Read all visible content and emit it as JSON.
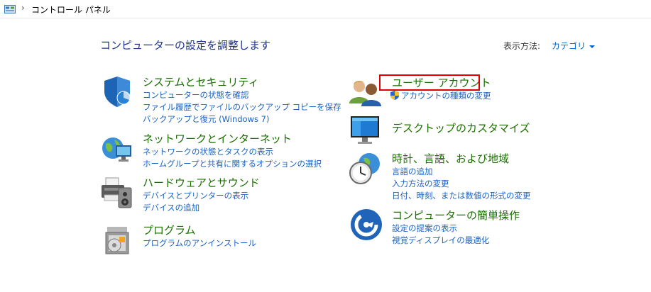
{
  "address_bar": {
    "separator": "›",
    "breadcrumb": "コントロール パネル",
    "icon": "control-panel-icon"
  },
  "heading": "コンピューターの設定を調整します",
  "view_by": {
    "label": "表示方法:",
    "value": "カテゴリ"
  },
  "highlight_color": "#e00000",
  "categories_left": [
    {
      "title": "システムとセキュリティ",
      "icon": "shield-icon",
      "links": [
        "コンピューターの状態を確認",
        "ファイル履歴でファイルのバックアップ コピーを保存",
        "バックアップと復元 (Windows 7)"
      ]
    },
    {
      "title": "ネットワークとインターネット",
      "icon": "network-globe-icon",
      "links": [
        "ネットワークの状態とタスクの表示",
        "ホームグループと共有に関するオプションの選択"
      ]
    },
    {
      "title": "ハードウェアとサウンド",
      "icon": "printer-speaker-icon",
      "links": [
        "デバイスとプリンターの表示",
        "デバイスの追加"
      ]
    },
    {
      "title": "プログラム",
      "icon": "programs-box-icon",
      "links": [
        "プログラムのアンインストール"
      ]
    }
  ],
  "categories_right": [
    {
      "title": "ユーザー アカウント",
      "icon": "users-icon",
      "links": [
        "アカウントの種類の変更"
      ]
    },
    {
      "title": "デスクトップのカスタマイズ",
      "icon": "monitor-icon",
      "links": []
    },
    {
      "title": "時計、言語、および地域",
      "icon": "clock-globe-icon",
      "links": [
        "言語の追加",
        "入力方法の変更",
        "日付、時刻、または数値の形式の変更"
      ]
    },
    {
      "title": "コンピューターの簡単操作",
      "icon": "ease-of-access-icon",
      "links": [
        "設定の提案の表示",
        "視覚ディスプレイの最適化"
      ]
    }
  ]
}
